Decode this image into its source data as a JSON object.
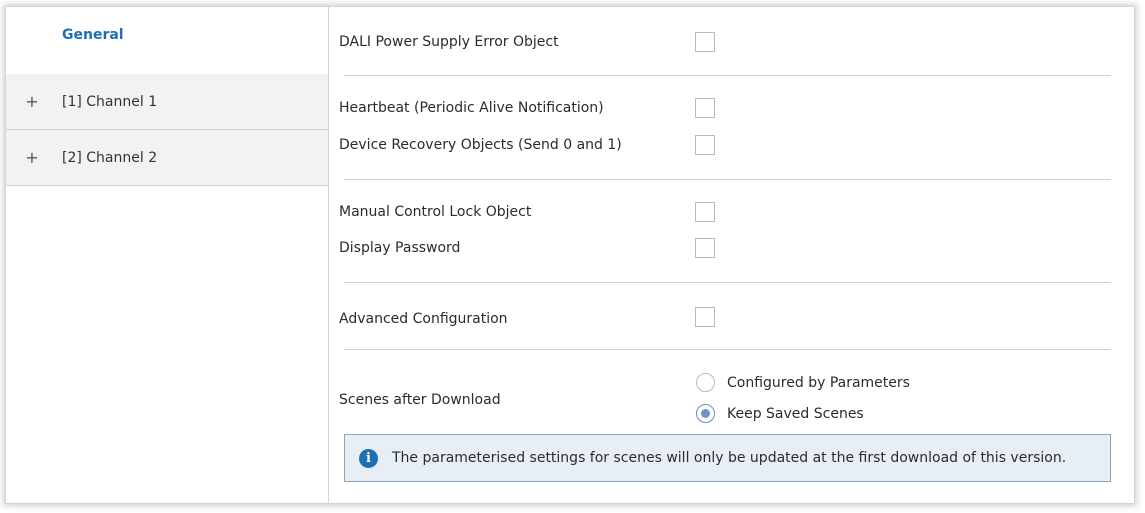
{
  "sidebar": {
    "items": [
      {
        "label": "General",
        "expander": ""
      },
      {
        "label": "[1] Channel 1",
        "expander": "+"
      },
      {
        "label": "[2] Channel 2",
        "expander": "+"
      }
    ]
  },
  "main": {
    "dali_power_error": {
      "label": "DALI Power Supply Error Object",
      "checked": false
    },
    "heartbeat": {
      "label": "Heartbeat (Periodic Alive Notification)",
      "checked": false
    },
    "device_recovery": {
      "label": "Device Recovery Objects (Send 0 and 1)",
      "checked": false
    },
    "manual_lock": {
      "label": "Manual Control Lock Object",
      "checked": false
    },
    "display_password": {
      "label": "Display Password",
      "checked": false
    },
    "advanced_config": {
      "label": "Advanced Configuration",
      "checked": false
    },
    "scenes": {
      "label": "Scenes after Download",
      "options": [
        "Configured by Parameters",
        "Keep Saved Scenes"
      ],
      "selected": "Keep Saved Scenes"
    },
    "info": {
      "icon": "info-icon",
      "text": "The parameterised settings for scenes will only be updated at the first download of this version."
    }
  },
  "colors": {
    "accent": "#1f6fb4",
    "info_bg": "#e8eef5",
    "info_border": "#8aa4c5"
  }
}
